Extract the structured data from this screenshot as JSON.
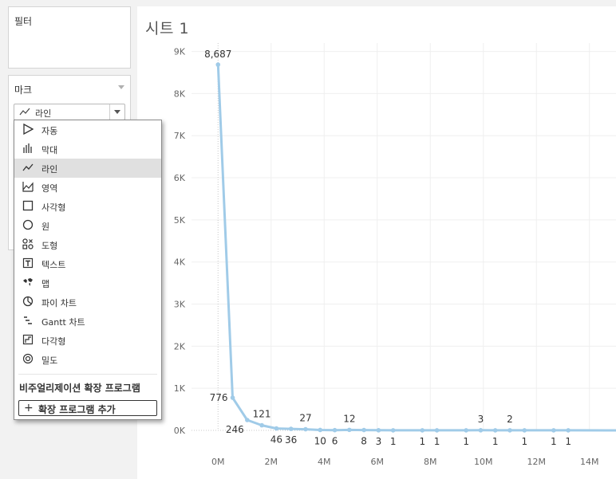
{
  "filters": {
    "title": "필터"
  },
  "marks": {
    "title": "마크",
    "selected_type": "라인",
    "options": [
      {
        "label": "자동",
        "icon": "auto-triangle-icon"
      },
      {
        "label": "막대",
        "icon": "bar-icon"
      },
      {
        "label": "라인",
        "icon": "line-icon",
        "selected": true
      },
      {
        "label": "영역",
        "icon": "area-icon"
      },
      {
        "label": "사각형",
        "icon": "square-icon"
      },
      {
        "label": "원",
        "icon": "circle-icon"
      },
      {
        "label": "도형",
        "icon": "shapes-icon"
      },
      {
        "label": "텍스트",
        "icon": "text-icon"
      },
      {
        "label": "맵",
        "icon": "map-icon"
      },
      {
        "label": "파이 차트",
        "icon": "pie-icon"
      },
      {
        "label": "Gantt 차트",
        "icon": "gantt-icon"
      },
      {
        "label": "다각형",
        "icon": "polygon-icon"
      },
      {
        "label": "밀도",
        "icon": "density-icon"
      }
    ],
    "extensions_header": "비주얼리제이션 확장 프로그램",
    "add_extension_label": "확장 프로그램 추가",
    "add_extension_icon": "+"
  },
  "sheet": {
    "title": "시트 1"
  },
  "chart_data": {
    "type": "line",
    "line_color": "#a0cbe8",
    "xlabel": "",
    "ylabel": "",
    "xlim": [
      -1000000,
      15000000
    ],
    "ylim": [
      0,
      9200
    ],
    "x_ticks": [
      "0M",
      "2M",
      "4M",
      "6M",
      "8M",
      "10M",
      "12M",
      "14M"
    ],
    "x_tick_values": [
      0,
      2000000,
      4000000,
      6000000,
      8000000,
      10000000,
      12000000,
      14000000
    ],
    "y_ticks": [
      "0K",
      "1K",
      "2K",
      "3K",
      "4K",
      "5K",
      "6K",
      "7K",
      "8K",
      "9K"
    ],
    "y_tick_values": [
      0,
      1000,
      2000,
      3000,
      4000,
      5000,
      6000,
      7000,
      8000,
      9000
    ],
    "points": [
      {
        "x": 0,
        "y": 8687,
        "label": "8,687"
      },
      {
        "x": 550000,
        "y": 776,
        "label": "776"
      },
      {
        "x": 1100000,
        "y": 246,
        "label": "246"
      },
      {
        "x": 1650000,
        "y": 121,
        "label": "121"
      },
      {
        "x": 2200000,
        "y": 46,
        "label": "46"
      },
      {
        "x": 2750000,
        "y": 36,
        "label": "36"
      },
      {
        "x": 3300000,
        "y": 27,
        "label": "27"
      },
      {
        "x": 3850000,
        "y": 10,
        "label": "10"
      },
      {
        "x": 4400000,
        "y": 6,
        "label": "6"
      },
      {
        "x": 4950000,
        "y": 12,
        "label": "12"
      },
      {
        "x": 5500000,
        "y": 8,
        "label": "8"
      },
      {
        "x": 6050000,
        "y": 3,
        "label": "3"
      },
      {
        "x": 6600000,
        "y": 1,
        "label": "1"
      },
      {
        "x": 7700000,
        "y": 1,
        "label": "1"
      },
      {
        "x": 8250000,
        "y": 1,
        "label": "1"
      },
      {
        "x": 9350000,
        "y": 1,
        "label": "1"
      },
      {
        "x": 9900000,
        "y": 3,
        "label": "3"
      },
      {
        "x": 10450000,
        "y": 1,
        "label": "1"
      },
      {
        "x": 11000000,
        "y": 2,
        "label": "2"
      },
      {
        "x": 11550000,
        "y": 1,
        "label": "1"
      },
      {
        "x": 12650000,
        "y": 1,
        "label": "1"
      },
      {
        "x": 13200000,
        "y": 1,
        "label": "1"
      }
    ]
  }
}
